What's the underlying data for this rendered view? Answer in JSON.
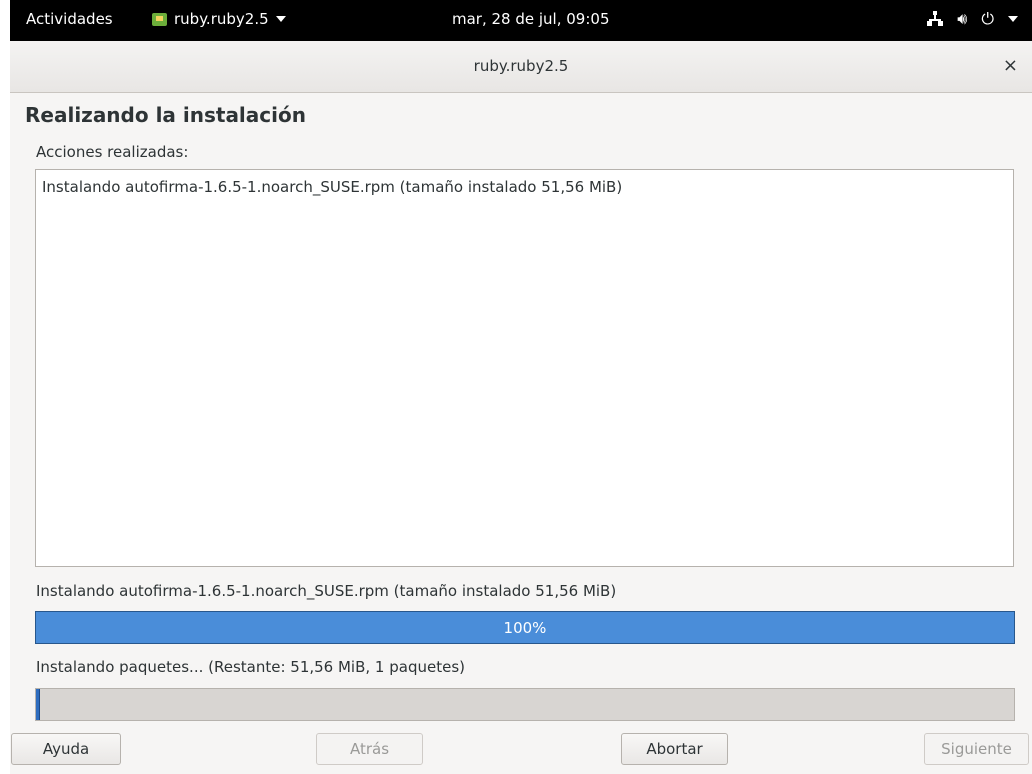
{
  "topbar": {
    "activities": "Actividades",
    "app_name": "ruby.ruby2.5",
    "clock": "mar, 28 de jul, 09:05"
  },
  "window": {
    "title": "ruby.ruby2.5",
    "close": "×"
  },
  "main": {
    "heading": "Realizando la instalación",
    "actions_label": "Acciones realizadas:",
    "log_lines": [
      "Instalando autofirma-1.6.5-1.noarch_SUSE.rpm (tamaño instalado 51,56 MiB)"
    ]
  },
  "progress": {
    "current_status": "Instalando autofirma-1.6.5-1.noarch_SUSE.rpm (tamaño instalado 51,56 MiB)",
    "current_percent_label": "100%",
    "current_fraction": 1.0,
    "overall_status": "Instalando paquetes... (Restante: 51,56 MiB, 1 paquetes)",
    "overall_fraction": 0.003
  },
  "buttons": {
    "help": "Ayuda",
    "back": "Atrás",
    "abort": "Abortar",
    "next": "Siguiente"
  }
}
